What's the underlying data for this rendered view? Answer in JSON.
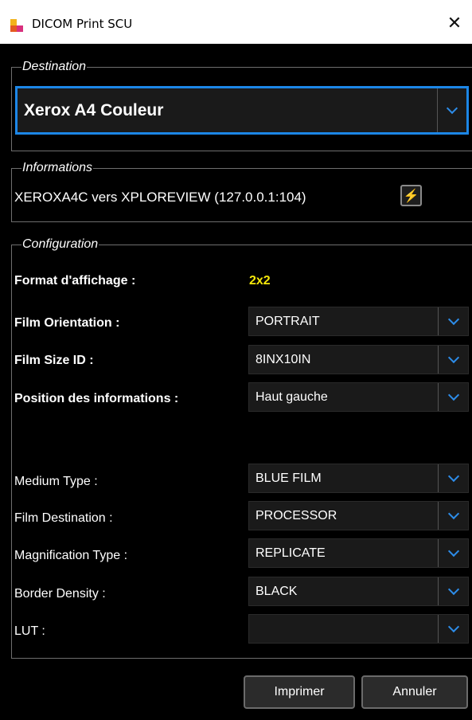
{
  "window": {
    "title": "DICOM Print SCU",
    "close_glyph": "✕",
    "icon": "dicom-app-icon"
  },
  "destination": {
    "legend": "Destination",
    "selected": "Xerox A4 Couleur"
  },
  "informations": {
    "legend": "Informations",
    "text": "XEROXA4C vers XPLOREVIEW (127.0.0.1:104)",
    "action_icon": "lightning-icon",
    "action_glyph": "⚡"
  },
  "configuration": {
    "legend": "Configuration",
    "format_label": "Format d'affichage :",
    "format_value": "2x2",
    "film_orientation_label": "Film Orientation :",
    "film_orientation_value": "PORTRAIT",
    "film_size_label": "Film Size ID :",
    "film_size_value": "8INX10IN",
    "position_label": "Position des informations :",
    "position_value": "Haut gauche",
    "medium_type_label": "Medium Type :",
    "medium_type_value": "BLUE FILM",
    "film_destination_label": "Film Destination :",
    "film_destination_value": "PROCESSOR",
    "magnification_label": "Magnification Type :",
    "magnification_value": "REPLICATE",
    "border_density_label": "Border Density :",
    "border_density_value": "BLACK",
    "lut_label": "LUT :",
    "lut_value": ""
  },
  "buttons": {
    "print": "Imprimer",
    "cancel": "Annuler"
  },
  "colors": {
    "accent": "#1c86e6",
    "highlight": "#f5e80a",
    "background": "#000000"
  }
}
